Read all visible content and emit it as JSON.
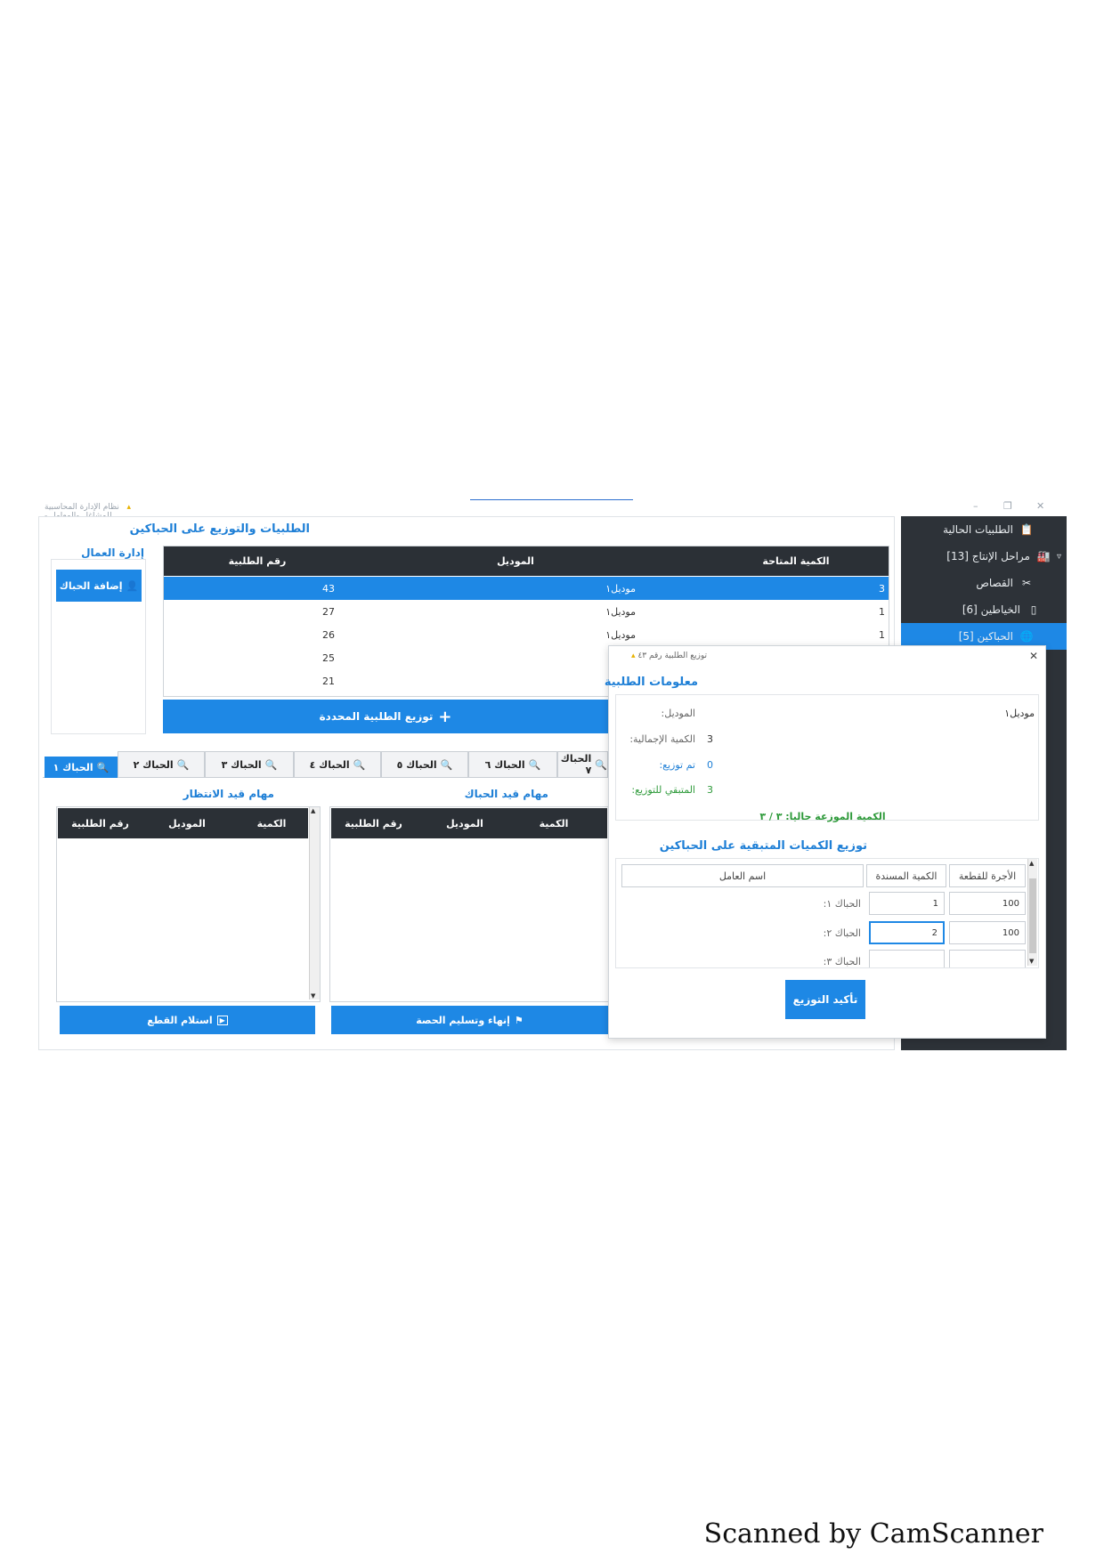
{
  "window": {
    "title": "نظام الإدارة المحاسبية للمشاغل والمعامل - المستخدم: admin (manager)",
    "controls": [
      "–",
      "❐",
      "✕"
    ]
  },
  "sidebar": {
    "items": [
      {
        "label": "الطلبيات الحالية",
        "icon": "clipboard-icon"
      },
      {
        "label": "مراحل الإنتاج [13]",
        "icon": "factory-icon",
        "expander": "▿"
      },
      {
        "label": "القصاص",
        "icon": "scissors-icon"
      },
      {
        "label": "الخياطين [6]",
        "icon": "square-icon"
      },
      {
        "label": "الحباكين [5]",
        "icon": "globe-icon"
      }
    ]
  },
  "main": {
    "title": "الطلبيات والتوزيع على الحباكين",
    "workers_title": "إدارة العمال",
    "add_worker_button": "إضافة الحباك",
    "orders_table": {
      "columns": [
        "الكمية المتاحة",
        "الموديل",
        "رقم الطلبية"
      ],
      "rows": [
        {
          "qty": "3",
          "model": "موديل١",
          "order": "43"
        },
        {
          "qty": "1",
          "model": "موديل١",
          "order": "27"
        },
        {
          "qty": "1",
          "model": "موديل١",
          "order": "26"
        },
        {
          "qty": "",
          "model": "",
          "order": "25"
        },
        {
          "qty": "",
          "model": "",
          "order": "21"
        }
      ]
    },
    "distribute_button": "توزيع الطلبية المحددة",
    "tabs": [
      "الحباك ١",
      "الحباك ٢",
      "الحباك ٣",
      "الحباك ٤",
      "الحباك ٥",
      "الحباك ٦",
      "الحباك ٧"
    ],
    "waiting_title": "مهام قيد الانتظار",
    "inprogress_title": "مهام قيد الحباك",
    "task_columns": [
      "الكمية",
      "الموديل",
      "رقم الطلبية"
    ],
    "receive_button": "استلام القطع",
    "finish_button": "إنهاء وتسليم الحصة"
  },
  "dialog": {
    "title": "توزيع الطلبية رقم ٤٣",
    "info_title": "معلومات الطلبية",
    "model_label": "الموديل:",
    "model_value": "موديل١",
    "total_label": "الكمية الإجمالية:",
    "total_value": "3",
    "distributed_label": "تم توزيع:",
    "distributed_value": "0",
    "remaining_label": "المتبقي للتوزيع:",
    "remaining_value": "3",
    "current_summary": "الكمية الموزعة حاليا: ٣ / ٣",
    "dist_title": "توزيع الكميات المتبقية على الحباكين",
    "dist_columns": [
      "اسم العامل",
      "الكمية المسندة",
      "الأجرة للقطعة"
    ],
    "workers": [
      {
        "name": "الحباك ١:",
        "qty": "1",
        "rate": "100"
      },
      {
        "name": "الحباك ٢:",
        "qty": "2",
        "rate": "100"
      },
      {
        "name": "الحباك ٣:",
        "qty": "",
        "rate": ""
      }
    ],
    "confirm_button": "تأكيد التوزيع",
    "close": "✕"
  },
  "footer": {
    "text": "Scanned by CamScanner"
  },
  "colors": {
    "accent": "#1e88e5",
    "dark": "#2b3036",
    "green": "#2e9a3a",
    "blue_text": "#1e7fd6"
  }
}
